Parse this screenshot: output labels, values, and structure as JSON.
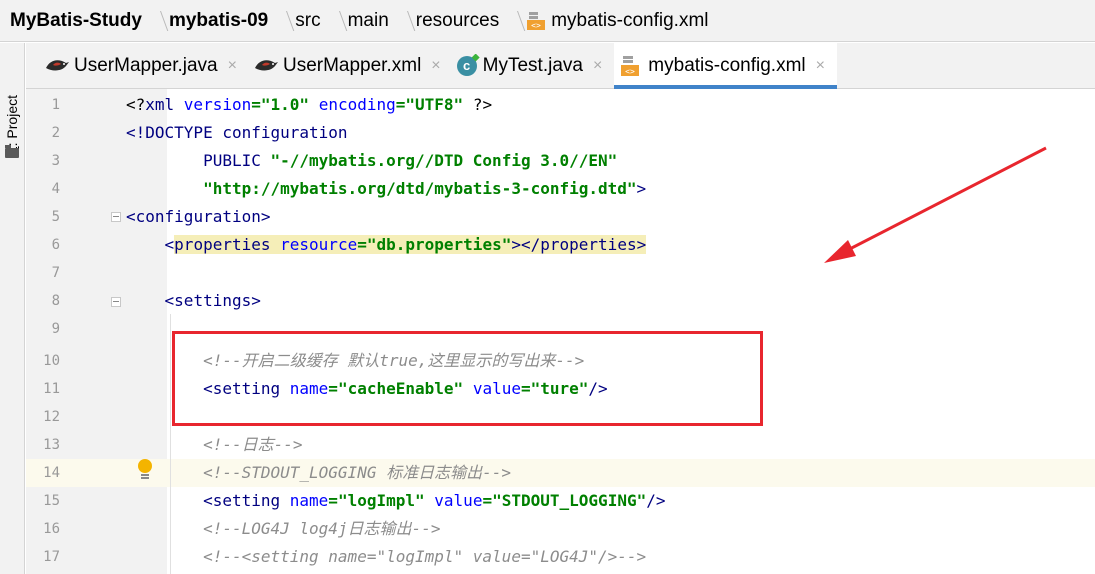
{
  "breadcrumb": {
    "items": [
      {
        "label": "MyBatis-Study",
        "bold": true
      },
      {
        "label": "mybatis-09",
        "bold": true
      },
      {
        "label": "src",
        "bold": false
      },
      {
        "label": "main",
        "bold": false
      },
      {
        "label": "resources",
        "bold": false
      },
      {
        "label": "mybatis-config.xml",
        "bold": false,
        "icon": "xml-file-icon"
      }
    ]
  },
  "sidebar": {
    "project_label_num": "1",
    "project_label_text": ": Project",
    "folder_icon": "folder-icon"
  },
  "tabs": [
    {
      "label": "UserMapper.java",
      "icon": "mybatis-bird-icon",
      "close": "×",
      "active": false
    },
    {
      "label": "UserMapper.xml",
      "icon": "mybatis-bird-icon",
      "close": "×",
      "active": false
    },
    {
      "label": "MyTest.java",
      "icon": "java-class-icon",
      "close": "×",
      "active": false
    },
    {
      "label": "mybatis-config.xml",
      "icon": "xml-file-icon",
      "close": "×",
      "active": true
    }
  ],
  "editor": {
    "lines": [
      {
        "num": "1"
      },
      {
        "num": "2"
      },
      {
        "num": "3"
      },
      {
        "num": "4"
      },
      {
        "num": "5"
      },
      {
        "num": "6"
      },
      {
        "num": "7"
      },
      {
        "num": "8"
      },
      {
        "num": "9"
      },
      {
        "num": "10"
      },
      {
        "num": "11"
      },
      {
        "num": "12"
      },
      {
        "num": "13"
      },
      {
        "num": "14"
      },
      {
        "num": "15"
      },
      {
        "num": "16"
      },
      {
        "num": "17"
      }
    ],
    "code": {
      "l1_a": "<?",
      "l1_b": "xml ",
      "l1_c": "version",
      "l1_d": "=",
      "l1_e": "\"1.0\"",
      "l1_f": " ",
      "l1_g": "encoding",
      "l1_h": "=",
      "l1_i": "\"UTF8\"",
      "l1_j": " ?>",
      "l2": "<!DOCTYPE configuration",
      "l3_a": "        PUBLIC ",
      "l3_b": "\"-//mybatis.org//DTD Config 3.0//EN\"",
      "l4_a": "        ",
      "l4_b": "\"http://mybatis.org/dtd/mybatis-3-config.dtd\"",
      "l4_c": ">",
      "l5_a": "<",
      "l5_b": "configuration",
      "l5_c": ">",
      "l6_a": "    <",
      "l6_b": "properties ",
      "l6_c": "resource",
      "l6_d": "=",
      "l6_e": "\"db.properties\"",
      "l6_f": "></",
      "l6_g": "properties",
      "l6_h": ">",
      "l8_a": "    <",
      "l8_b": "settings",
      "l8_c": ">",
      "l10": "        <!--开启二级缓存 默认true,这里显示的写出来-->",
      "l11_a": "        <",
      "l11_b": "setting ",
      "l11_c": "name",
      "l11_d": "=",
      "l11_e": "\"cacheEnable\"",
      "l11_f": " ",
      "l11_g": "value",
      "l11_h": "=",
      "l11_i": "\"ture\"",
      "l11_j": "/>",
      "l13": "        <!--日志-->",
      "l14": "        <!--STDOUT_LOGGING 标准日志输出-->",
      "l15_a": "        <",
      "l15_b": "setting ",
      "l15_c": "name",
      "l15_d": "=",
      "l15_e": "\"logImpl\"",
      "l15_f": " ",
      "l15_g": "value",
      "l15_h": "=",
      "l15_i": "\"STDOUT_LOGGING\"",
      "l15_j": "/>",
      "l16": "        <!--LOG4J log4j日志输出-->",
      "l17": "        <!--<setting name=\"logImpl\" value=\"LOG4J\"/>-->"
    },
    "lightbulb_icon": "lightbulb-icon",
    "annotation_color": "#e8262e"
  }
}
